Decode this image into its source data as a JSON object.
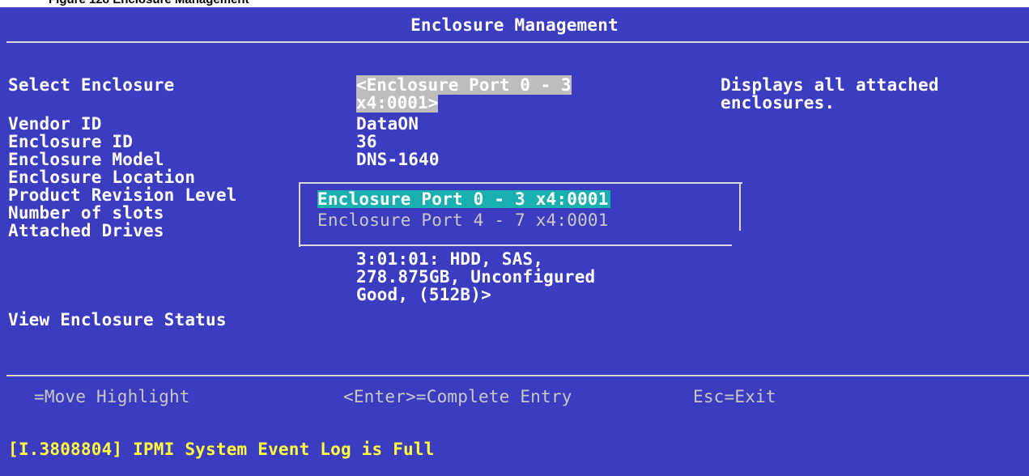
{
  "caption": "Figure 128 Enclosure Management",
  "header": {
    "title": "Enclosure Management"
  },
  "fields": {
    "select_enclosure": {
      "label": "Select Enclosure",
      "value": "<Enclosure Port 0 - 3 x4:0001>"
    },
    "vendor_id": {
      "label": "Vendor ID",
      "value": "DataON"
    },
    "enclosure_id": {
      "label": "Enclosure ID",
      "value": "36"
    },
    "enclosure_model": {
      "label": "Enclosure Model",
      "value": "DNS-1640"
    },
    "enclosure_location": {
      "label": "Enclosure Location"
    },
    "product_revision_level": {
      "label": "Product Revision Level"
    },
    "number_of_slots": {
      "label": "Number of slots"
    },
    "attached_drives": {
      "label": "Attached Drives",
      "value_lines": [
        "3:01:01: HDD, SAS,",
        "278.875GB, Unconfigured",
        "Good, (512B)>"
      ]
    },
    "view_enclosure_status": {
      "label": "View Enclosure Status"
    }
  },
  "help": {
    "lines": [
      "Displays all attached",
      "enclosures."
    ]
  },
  "popup": {
    "options": [
      "Enclosure Port 0 - 3 x4:0001",
      "Enclosure Port 4 - 7 x4:0001"
    ],
    "selected_index": 0
  },
  "footer": {
    "move_highlight": "=Move Highlight",
    "complete_entry": "<Enter>=Complete Entry",
    "exit": "Esc=Exit"
  },
  "status": {
    "message": "[I.3808804] IPMI System Event Log is Full"
  },
  "colors": {
    "background": "#3c3cc0",
    "text": "#ffffff",
    "dim_text": "#c8c8c8",
    "highlight": "#1ab0b0",
    "field_highlight": "#bdbdbd",
    "status_text": "#ffff3c"
  }
}
